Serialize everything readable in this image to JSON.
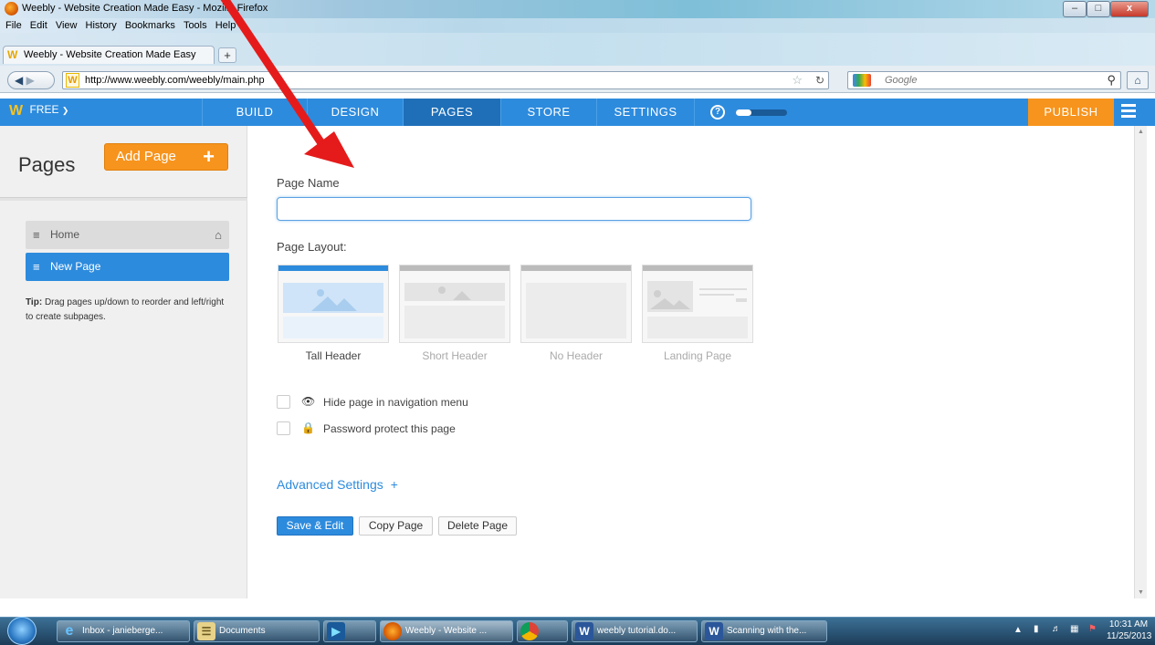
{
  "browser": {
    "window_title": "Weebly - Website Creation Made Easy - Mozilla Firefox",
    "menu": [
      "File",
      "Edit",
      "View",
      "History",
      "Bookmarks",
      "Tools",
      "Help"
    ],
    "tab_title": "Weebly - Website Creation Made Easy",
    "url": "http://www.weebly.com/weebly/main.php",
    "search_placeholder": "Google",
    "window_buttons": [
      "–",
      "□",
      "x"
    ]
  },
  "weebly_nav": {
    "plan": "FREE",
    "items": [
      {
        "label": "BUILD",
        "active": false
      },
      {
        "label": "DESIGN",
        "active": false
      },
      {
        "label": "PAGES",
        "active": true
      },
      {
        "label": "STORE",
        "active": false
      },
      {
        "label": "SETTINGS",
        "active": false
      }
    ],
    "help_symbol": "?",
    "progress": 0.3,
    "publish_label": "PUBLISH"
  },
  "sidebar": {
    "title": "Pages",
    "add_page_label": "Add Page",
    "pages": [
      {
        "label": "Home",
        "selected": false
      },
      {
        "label": "New Page",
        "selected": true
      }
    ],
    "tip_bold": "Tip:",
    "tip_text": "Drag pages up/down to reorder and left/right to create subpages."
  },
  "editor": {
    "page_name_label": "Page Name",
    "page_name_value": "",
    "page_layout_label": "Page Layout:",
    "layouts": [
      {
        "label": "Tall Header",
        "selected": true
      },
      {
        "label": "Short Header",
        "selected": false
      },
      {
        "label": "No Header",
        "selected": false
      },
      {
        "label": "Landing Page",
        "selected": false
      }
    ],
    "options": [
      {
        "label": "Hide page in navigation menu",
        "checked": false,
        "icon": "eye-hide-icon"
      },
      {
        "label": "Password protect this page",
        "checked": false,
        "icon": "lock-icon"
      }
    ],
    "advanced_settings_label": "Advanced Settings",
    "buttons": {
      "save": "Save & Edit",
      "copy": "Copy Page",
      "delete": "Delete Page"
    }
  },
  "taskbar": {
    "items": [
      {
        "label": "Inbox - janieberge...",
        "icon": "ie-icon"
      },
      {
        "label": "Documents",
        "icon": "folder-icon"
      },
      {
        "label": "",
        "icon": "media-player-icon"
      },
      {
        "label": "Weebly - Website ...",
        "icon": "firefox-icon"
      },
      {
        "label": "",
        "icon": "chrome-icon"
      },
      {
        "label": "weebly tutorial.do...",
        "icon": "word-icon"
      },
      {
        "label": "Scanning with the...",
        "icon": "word-icon"
      }
    ],
    "time": "10:31 AM",
    "date": "11/25/2013"
  },
  "annotation": {
    "color": "#e51b1b"
  }
}
